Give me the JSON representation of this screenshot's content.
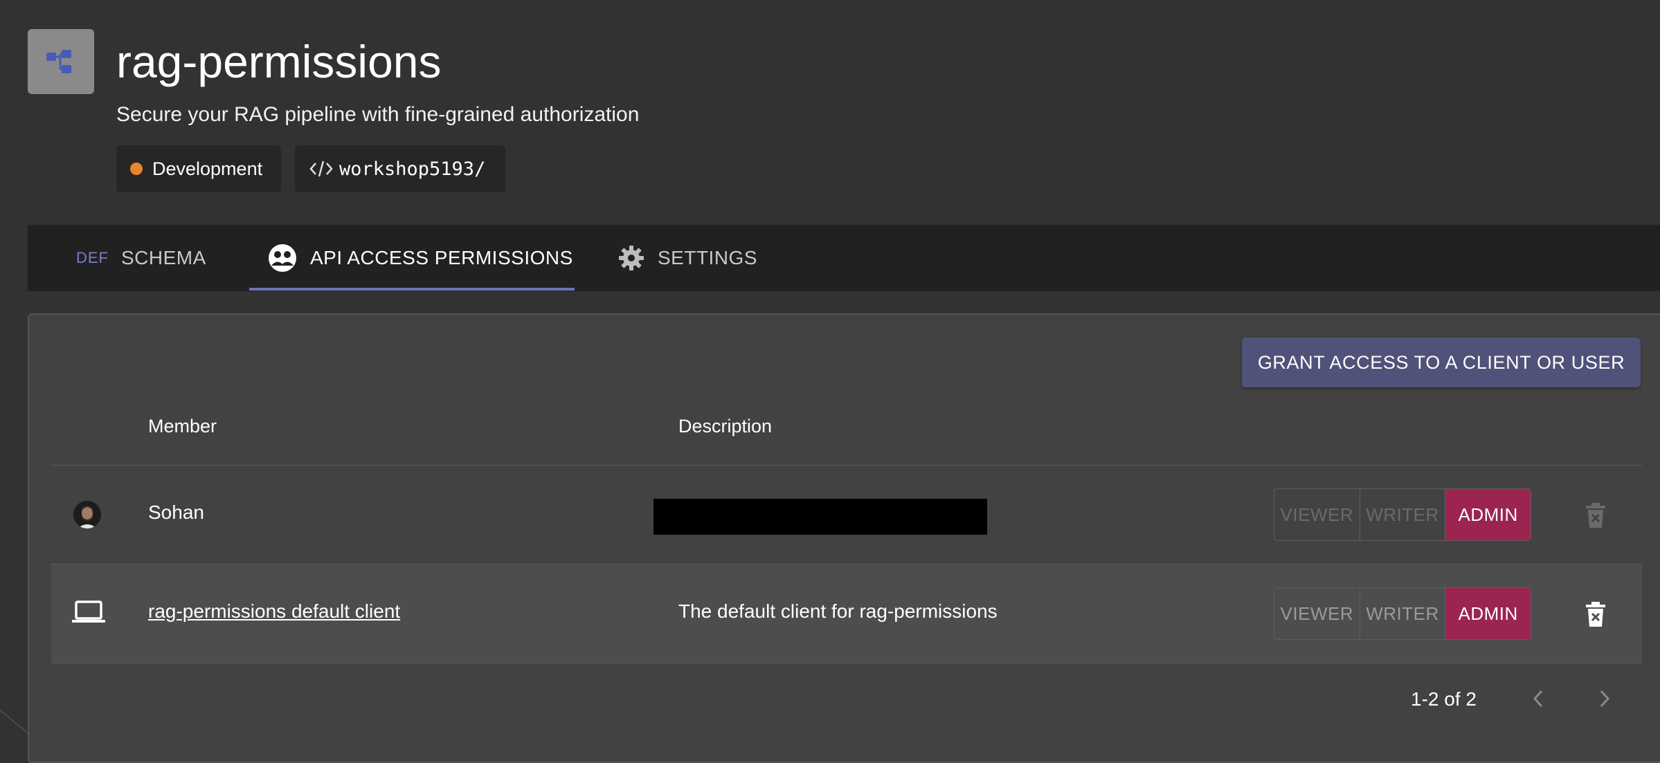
{
  "app": {
    "title": "rag-permissions",
    "subtitle": "Secure your RAG pipeline with fine-grained authorization",
    "icon": "hierarchy-icon",
    "environment": {
      "label": "Development",
      "status_color": "#e8852f"
    },
    "slug": "workshop5193/"
  },
  "tabs": {
    "schema": {
      "prefix": "DEF",
      "label": "SCHEMA"
    },
    "api": {
      "label": "API ACCESS PERMISSIONS",
      "icon": "people-icon",
      "active": true
    },
    "settings": {
      "label": "SETTINGS",
      "icon": "gear-icon"
    }
  },
  "permissions": {
    "grant_button": "GRANT ACCESS TO A CLIENT OR USER",
    "columns": {
      "member": "Member",
      "description": "Description"
    },
    "rows": [
      {
        "member": "Sohan",
        "type": "user",
        "description": "",
        "description_redacted": true,
        "role": "ADMIN"
      },
      {
        "member": "rag-permissions default client",
        "type": "client",
        "description": "The default client for rag-permissions",
        "role": "ADMIN"
      }
    ],
    "roles": [
      "VIEWER",
      "WRITER",
      "ADMIN"
    ],
    "pagination": "1-2 of 2"
  },
  "colors": {
    "accent": "#515279",
    "tab_underline": "#6d72b8",
    "admin_active": "#9b2550"
  }
}
